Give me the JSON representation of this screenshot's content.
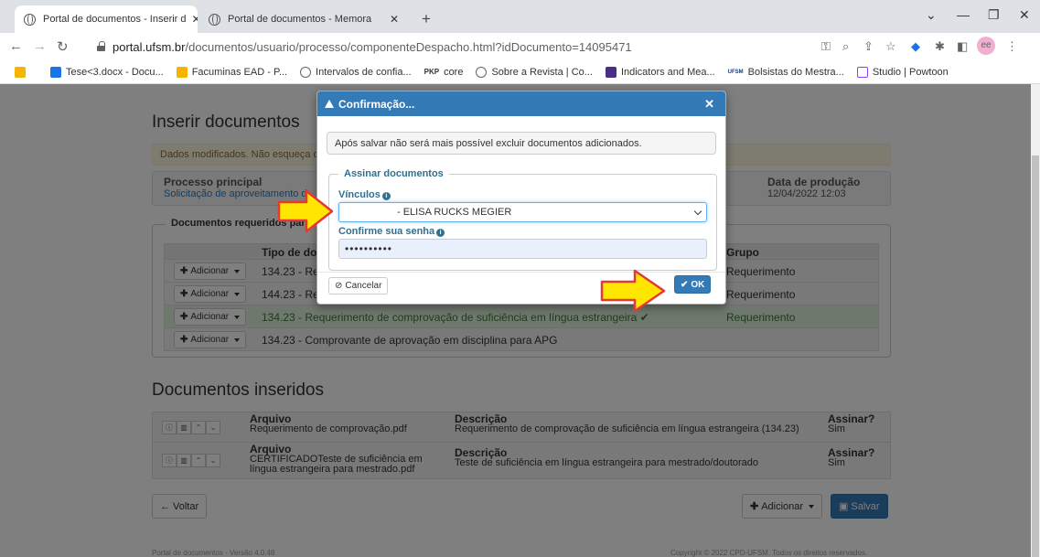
{
  "browser": {
    "tabs": [
      {
        "title": "Portal de documentos - Inserir d",
        "close": "✕"
      },
      {
        "title": "Portal de documentos - Memora",
        "close": "✕"
      }
    ],
    "new_tab": "+",
    "url_host": "portal.ufsm.br",
    "url_path": "/documentos/usuario/processo/componenteDespacho.html?idDocumento=14095471",
    "bookmarks": [
      {
        "label": "Tese<3.docx - Docu...",
        "color": "#1a73e8"
      },
      {
        "label": "Facuminas EAD - P...",
        "color": "#f4b400"
      },
      {
        "label": "Intervalos de confia...",
        "color": "#5f6368"
      },
      {
        "label": "core",
        "prefix": "PKP",
        "color": "#333333"
      },
      {
        "label": "Sobre a Revista | Co...",
        "color": "#5f6368"
      },
      {
        "label": "Indicators and Mea...",
        "color": "#4a2c8a"
      },
      {
        "label": "Bolsistas do Mestra...",
        "prefix": "UFSM",
        "color": "#1a3d7c"
      },
      {
        "label": "Studio | Powtoon",
        "color": "#8a3ffc"
      }
    ]
  },
  "page": {
    "title": "Inserir documentos",
    "alert": "Dados modificados. Não esqueça d",
    "processo_label": "Processo principal",
    "processo_value": "Solicitação de aproveitamento d",
    "data_label": "Data de produção",
    "data_value": "12/04/2022 12:03",
    "req_legend": "Documentos requeridos par",
    "req_header_tipo": "Tipo de doc",
    "req_header_grupo": "Grupo",
    "add_label": "Adicionar",
    "req_rows": [
      {
        "tipo": "134.23 - Req",
        "grupo": "Requerimento",
        "ok": false
      },
      {
        "tipo": "144.23 - Req",
        "grupo": "Requerimento",
        "ok": false
      },
      {
        "tipo": "134.23 - Requerimento de comprovação de suficiência em língua estrangeira ✔",
        "grupo": "Requerimento",
        "ok": true
      },
      {
        "tipo": "134.23 - Comprovante de aprovação em disciplina para APG",
        "grupo": "",
        "ok": false
      }
    ],
    "ins_title": "Documentos inseridos",
    "ins_rows": [
      {
        "arquivo_label": "Arquivo",
        "arquivo": "Requerimento de comprovação.pdf",
        "arquivo2": "",
        "desc_label": "Descrição",
        "desc": "Requerimento de comprovação de suficiência em língua estrangeira (134.23)",
        "assinar_label": "Assinar?",
        "assinar": "Sim"
      },
      {
        "arquivo_label": "Arquivo",
        "arquivo": "CERTIFICADOTeste de suficiência em",
        "arquivo2": "língua estrangeira para mestrado.pdf",
        "desc_label": "Descrição",
        "desc": "Teste de suficiência em língua estrangeira para mestrado/doutorado",
        "assinar_label": "Assinar?",
        "assinar": "Sim"
      }
    ],
    "voltar": "Voltar",
    "adicionar": "Adicionar",
    "salvar": "Salvar",
    "footer_left": "Portal de documentos - Versão 4.0.48",
    "footer_right": "Copyright © 2022 CPD-UFSM. Todos os direitos reservados."
  },
  "modal": {
    "title": "Confirmação...",
    "close": "✕",
    "info": "Após salvar não será mais possível excluir documentos adicionados.",
    "legend": "Assinar documentos",
    "vinculos_label": "Vínculos",
    "vinculos_value": "- ELISA RUCKS MEGIER",
    "senha_label": "Confirme sua senha",
    "senha_value": "••••••••••",
    "cancel": "Cancelar",
    "ok": "OK"
  },
  "colors": {
    "primary": "#337ab7",
    "arrow": "#ffe600",
    "arrow_stroke": "#e53935"
  }
}
